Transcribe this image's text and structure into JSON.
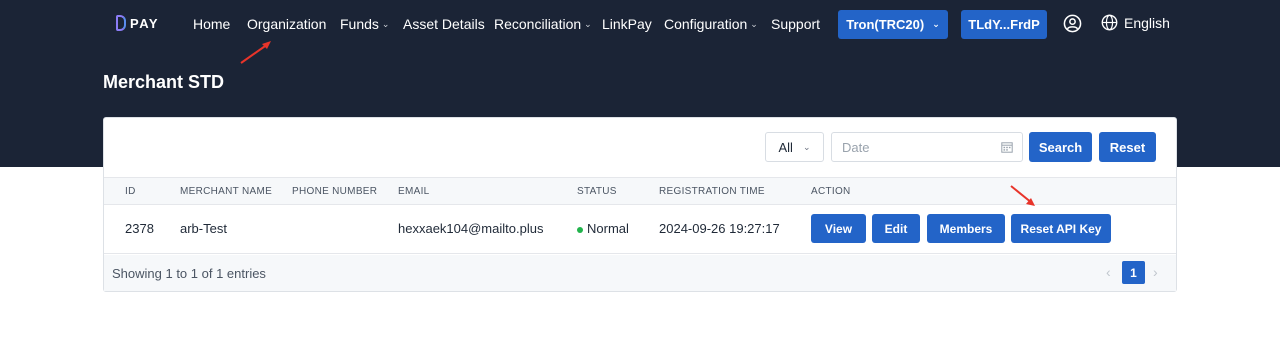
{
  "app": {
    "logo_text": "PAY"
  },
  "nav": {
    "items": [
      {
        "label": "Home",
        "caret": ""
      },
      {
        "label": "Organization",
        "caret": ""
      },
      {
        "label": "Funds",
        "caret": "⌄"
      },
      {
        "label": "Asset Details",
        "caret": ""
      },
      {
        "label": "Reconciliation",
        "caret": "⌄"
      },
      {
        "label": "LinkPay",
        "caret": ""
      },
      {
        "label": "Configuration",
        "caret": "⌄"
      },
      {
        "label": "Support",
        "caret": ""
      }
    ],
    "network_button": "Tron(TRC20)",
    "network_caret": "⌄",
    "wallet_button": "TLdY...FrdP",
    "language": "English"
  },
  "page": {
    "title": "Merchant STD"
  },
  "filters": {
    "status_select": "All",
    "status_caret": "⌄",
    "date_placeholder": "Date",
    "search_label": "Search",
    "reset_label": "Reset"
  },
  "table": {
    "columns": [
      "ID",
      "MERCHANT NAME",
      "PHONE NUMBER",
      "EMAIL",
      "STATUS",
      "REGISTRATION TIME",
      "ACTION"
    ],
    "rows": [
      {
        "id": "2378",
        "merchant_name": "arb-Test",
        "phone_number": "",
        "email": "hexxaek104@mailto.plus",
        "status": "Normal",
        "registration_time": "2024-09-26 19:27:17",
        "actions": [
          "View",
          "Edit",
          "Members",
          "Reset API Key"
        ]
      }
    ]
  },
  "pagination": {
    "info": "Showing 1 to 1 of 1 entries",
    "prev": "‹",
    "current_page": "1",
    "next": "›"
  },
  "colors": {
    "header_bg": "#1b2436",
    "primary": "#2364c8",
    "status_normal": "#22b34c",
    "annotation_arrow": "#e8342a"
  }
}
